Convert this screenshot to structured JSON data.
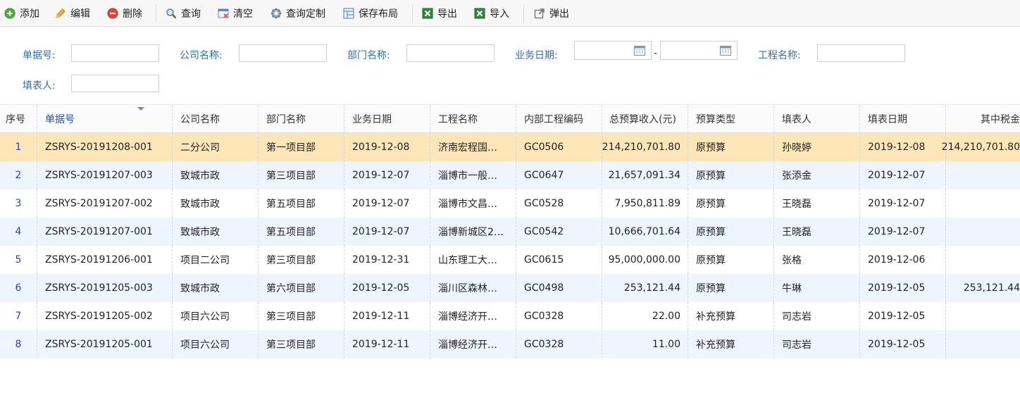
{
  "toolbar": {
    "add": "添加",
    "edit": "编辑",
    "delete": "删除",
    "query": "查询",
    "clear": "清空",
    "custom_query": "查询定制",
    "save_layout": "保存布局",
    "export": "导出",
    "import": "导入",
    "popout": "弹出"
  },
  "form": {
    "doc_no_label": "单据号:",
    "company_label": "公司名称:",
    "dept_label": "部门名称:",
    "biz_date_label": "业务日期:",
    "date_dash": "-",
    "project_label": "工程名称:",
    "filler_label": "填表人:"
  },
  "grid": {
    "columns": [
      "序号",
      "单据号",
      "公司名称",
      "部门名称",
      "业务日期",
      "工程名称",
      "内部工程编码",
      "总预算收入(元)",
      "预算类型",
      "填表人",
      "填表日期",
      "其中税金"
    ],
    "rows": [
      [
        "1",
        "ZSRYS-20191208-001",
        "二分公司",
        "第一项目部",
        "2019-12-08",
        "济南宏程国…",
        "GC0506",
        "214,210,701.80",
        "原预算",
        "孙晓婷",
        "2019-12-08",
        "214,210,701.80"
      ],
      [
        "2",
        "ZSRYS-20191207-003",
        "致城市政",
        "第三项目部",
        "2019-12-07",
        "淄博市一般…",
        "GC0647",
        "21,657,091.34",
        "原预算",
        "张添金",
        "2019-12-07",
        ""
      ],
      [
        "3",
        "ZSRYS-20191207-002",
        "致城市政",
        "第五项目部",
        "2019-12-07",
        "淄博市文昌…",
        "GC0528",
        "7,950,811.89",
        "原预算",
        "王晓磊",
        "2019-12-07",
        ""
      ],
      [
        "4",
        "ZSRYS-20191207-001",
        "致城市政",
        "第五项目部",
        "2019-12-07",
        "淄博新城区2…",
        "GC0542",
        "10,666,701.64",
        "原预算",
        "王晓磊",
        "2019-12-07",
        ""
      ],
      [
        "5",
        "ZSRYS-20191206-001",
        "项目二公司",
        "第三项目部",
        "2019-12-31",
        "山东理工大…",
        "GC0615",
        "95,000,000.00",
        "原预算",
        "张格",
        "2019-12-06",
        ""
      ],
      [
        "6",
        "ZSRYS-20191205-003",
        "致城市政",
        "第六项目部",
        "2019-12-05",
        "淄川区森林…",
        "GC0498",
        "253,121.44",
        "原预算",
        "牛琳",
        "2019-12-05",
        "253,121.44"
      ],
      [
        "7",
        "ZSRYS-20191205-002",
        "项目六公司",
        "第三项目部",
        "2019-12-11",
        "淄博经济开…",
        "GC0328",
        "22.00",
        "补充预算",
        "司志岩",
        "2019-12-05",
        ""
      ],
      [
        "8",
        "ZSRYS-20191205-001",
        "项目六公司",
        "第三项目部",
        "2019-12-11",
        "淄博经济开…",
        "GC0328",
        "11.00",
        "补充预算",
        "司志岩",
        "2019-12-05",
        ""
      ]
    ]
  }
}
